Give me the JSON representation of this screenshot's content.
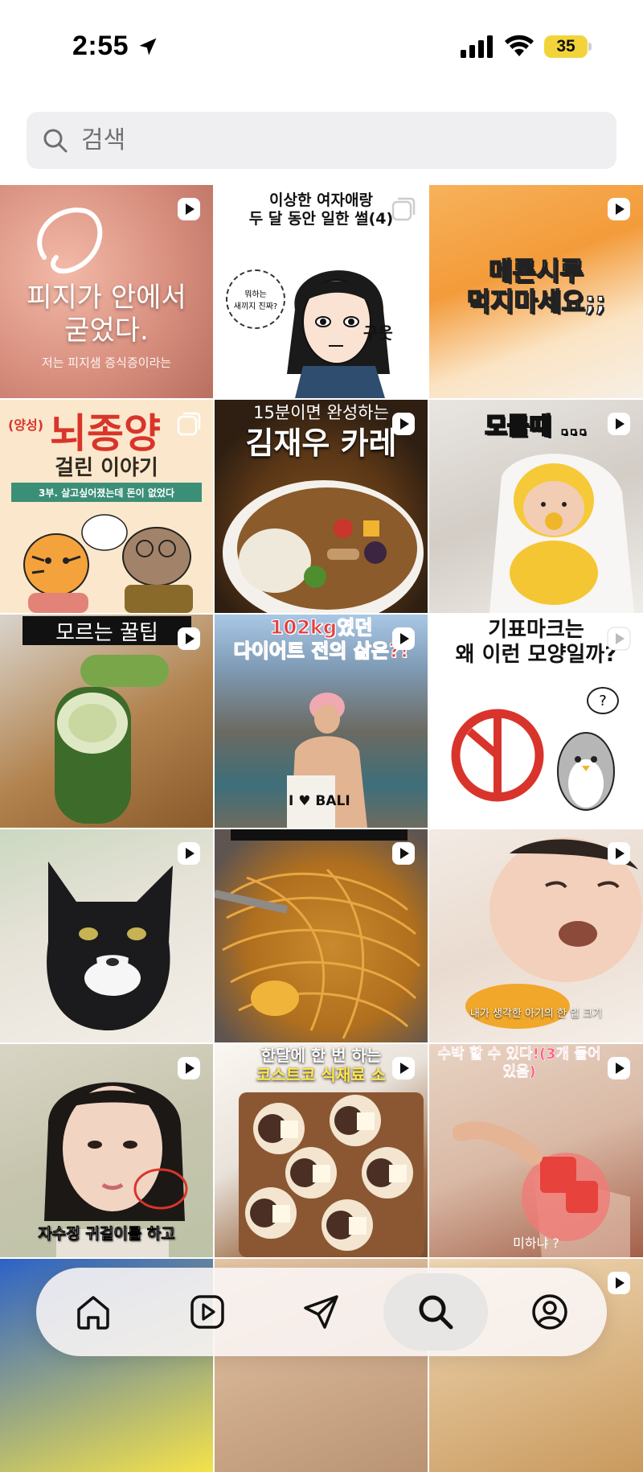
{
  "status_bar": {
    "time": "2:55",
    "battery": "35"
  },
  "search": {
    "placeholder": "검색"
  },
  "grid": {
    "tiles": [
      {
        "kind": "reel",
        "caption": "피지가 안에서\n굳었다.",
        "subcaption": "저는 피지샘 증식증이라는"
      },
      {
        "kind": "carousel",
        "caption": "이상한 여자애랑\n두 달 동안 일한 썰(4)",
        "bubble": "뭐하는\n새끼지 진짜?",
        "sfx": "구웃"
      },
      {
        "kind": "reel",
        "caption": "메론시루\n먹지마세요;;"
      },
      {
        "kind": "carousel",
        "tag": "(양성)",
        "caption": "뇌종양",
        "subcaption": "걸린 이야기",
        "banner": "3부. 살고싶어졌는데 돈이 없었다"
      },
      {
        "kind": "reel",
        "caption": "15분이면 완성하는",
        "subcaption": "김재우 카레"
      },
      {
        "kind": "reel",
        "caption": "모를때 ..."
      },
      {
        "kind": "reel",
        "caption": "모르는 꿀팁"
      },
      {
        "kind": "reel",
        "caption": "102kg였던\n다이어트 전의 삶은?!",
        "bag_text": "I ♥ BALI"
      },
      {
        "kind": "reel",
        "caption": "기표마크는\n왜 이런 모양일까?",
        "bubble": "?"
      },
      {
        "kind": "reel",
        "caption": ""
      },
      {
        "kind": "reel",
        "caption": ""
      },
      {
        "kind": "reel",
        "caption": "내가 생각한 아기의 한 입 크기"
      },
      {
        "kind": "reel",
        "caption": "자수정 귀걸이를 하고"
      },
      {
        "kind": "reel",
        "caption": "한달에 한 번 하는",
        "subcaption": "코스트코 식재료 소"
      },
      {
        "kind": "reel",
        "caption": "수박 할 수 있다!(3개 들어있음)",
        "subcaption": "미하냐 ?"
      },
      {
        "kind": "none",
        "caption": ""
      },
      {
        "kind": "none",
        "caption": ""
      },
      {
        "kind": "reel",
        "caption": ""
      }
    ]
  },
  "bottom_nav": {
    "items": [
      "home",
      "reels",
      "messages",
      "search",
      "profile"
    ],
    "active": "search"
  },
  "colors": {
    "accent_red": "#d9342b",
    "battery": "#f2d43a",
    "search_bg": "#efeff1"
  }
}
